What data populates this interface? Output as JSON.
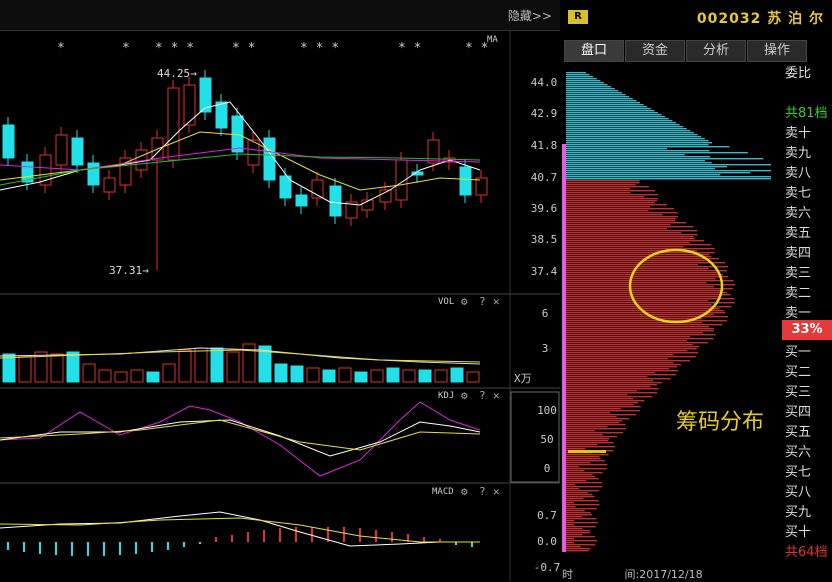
{
  "header": {
    "hide_label": "隐藏>>",
    "badge": "R",
    "stock_code": "002032",
    "stock_name": "苏 泊 尔"
  },
  "tabs": [
    "盘口",
    "资金",
    "分析",
    "操作"
  ],
  "price_axis": {
    "ticks": [
      "44.0",
      "42.9",
      "41.8",
      "40.7",
      "39.6",
      "38.5",
      "37.4"
    ],
    "high_label": "44.25→",
    "low_label": "37.31→",
    "ma_label": "MA"
  },
  "stars": [
    "*",
    "*",
    "* * *",
    "* *",
    "* * *",
    "* *",
    "* *"
  ],
  "vol": {
    "label": "VOL",
    "ticks": [
      "6",
      "3"
    ],
    "unit": "X万"
  },
  "kdj": {
    "label": "KDJ",
    "ticks": [
      "100",
      "50",
      "0"
    ]
  },
  "macd": {
    "label": "MACD",
    "ticks": [
      "0.7",
      "0.0",
      "-0.7"
    ]
  },
  "panel_icons": {
    "gear": "⚙",
    "help": "?",
    "close": "✕"
  },
  "order_book": {
    "weibi": "委比",
    "sell_total": "共81档",
    "sell": [
      "卖十",
      "卖九",
      "卖八",
      "卖七",
      "卖六",
      "卖五",
      "卖四",
      "卖三",
      "卖二",
      "卖一"
    ],
    "ratio": "33%",
    "buy": [
      "买一",
      "买二",
      "买三",
      "买四",
      "买五",
      "买六",
      "买七",
      "买八",
      "买九",
      "买十"
    ],
    "buy_total": "共64档"
  },
  "chip": {
    "label": "筹码分布",
    "time_label": "时",
    "date": "间:2017/12/18"
  },
  "colors": {
    "up": "#e03030",
    "down": "#22e0e8",
    "ma5": "#ffffff",
    "ma10": "#e8e030",
    "ma20": "#e020e0",
    "ma60": "#20c020",
    "chip_red": "#c03030",
    "chip_cyan": "#3ab8c8",
    "circle": "#e8d020"
  }
}
